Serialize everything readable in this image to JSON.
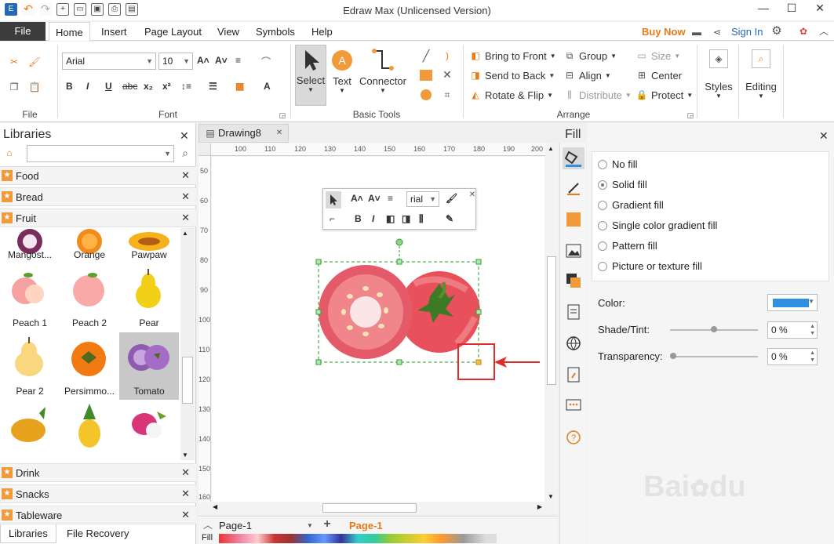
{
  "app": {
    "title": "Edraw Max (Unlicensed Version)"
  },
  "ribbon_tabs": {
    "file": "File",
    "home": "Home",
    "insert": "Insert",
    "page_layout": "Page Layout",
    "view": "View",
    "symbols": "Symbols",
    "help": "Help",
    "buy_now": "Buy Now",
    "sign_in": "Sign In"
  },
  "ribbon": {
    "file_group": "File",
    "font_group": "Font",
    "font_name": "Arial",
    "font_size": "10",
    "basic_tools_group": "Basic Tools",
    "select_label": "Select",
    "text_label": "Text",
    "connector_label": "Connector",
    "arrange_group": "Arrange",
    "bring_to_front": "Bring to Front",
    "send_to_back": "Send to Back",
    "rotate_flip": "Rotate & Flip",
    "group": "Group",
    "align": "Align",
    "distribute": "Distribute",
    "size": "Size",
    "center": "Center",
    "protect": "Protect",
    "styles": "Styles",
    "editing": "Editing"
  },
  "libraries": {
    "title": "Libraries",
    "search_value": "",
    "categories": [
      {
        "label": "Food"
      },
      {
        "label": "Bread"
      },
      {
        "label": "Fruit"
      },
      {
        "label": "Drink"
      },
      {
        "label": "Snacks"
      },
      {
        "label": "Tableware"
      }
    ],
    "shapes": [
      {
        "label": "Mangost..."
      },
      {
        "label": "Orange"
      },
      {
        "label": "Pawpaw"
      },
      {
        "label": "Peach 1"
      },
      {
        "label": "Peach 2"
      },
      {
        "label": "Pear"
      },
      {
        "label": "Pear 2"
      },
      {
        "label": "Persimmo..."
      },
      {
        "label": "Tomato"
      }
    ],
    "bottom_tabs": {
      "libraries": "Libraries",
      "file_recovery": "File Recovery"
    }
  },
  "document": {
    "tab_name": "Drawing8",
    "ruler_top": [
      "100",
      "110",
      "120",
      "130",
      "140",
      "150",
      "160",
      "170",
      "180",
      "190",
      "200"
    ],
    "ruler_left": [
      "50",
      "60",
      "70",
      "80",
      "90",
      "100",
      "110",
      "120",
      "130",
      "140",
      "150",
      "160"
    ],
    "page_tab": "Page-1",
    "active_page": "Page-1",
    "fill_label": "Fill"
  },
  "floatbar": {
    "font": "rial"
  },
  "fill_panel": {
    "title": "Fill",
    "options": [
      {
        "label": "No fill",
        "selected": false
      },
      {
        "label": "Solid fill",
        "selected": true
      },
      {
        "label": "Gradient fill",
        "selected": false
      },
      {
        "label": "Single color gradient fill",
        "selected": false
      },
      {
        "label": "Pattern fill",
        "selected": false
      },
      {
        "label": "Picture or texture fill",
        "selected": false
      }
    ],
    "color_label": "Color:",
    "color_value": "#2f8fe0",
    "shade_label": "Shade/Tint:",
    "shade_value": "0 %",
    "transparency_label": "Transparency:",
    "transparency_value": "0 %"
  },
  "colors": {
    "accent_orange": "#f19a3c",
    "annotation_red": "#e02b2b",
    "tomato": "#e8505b"
  }
}
